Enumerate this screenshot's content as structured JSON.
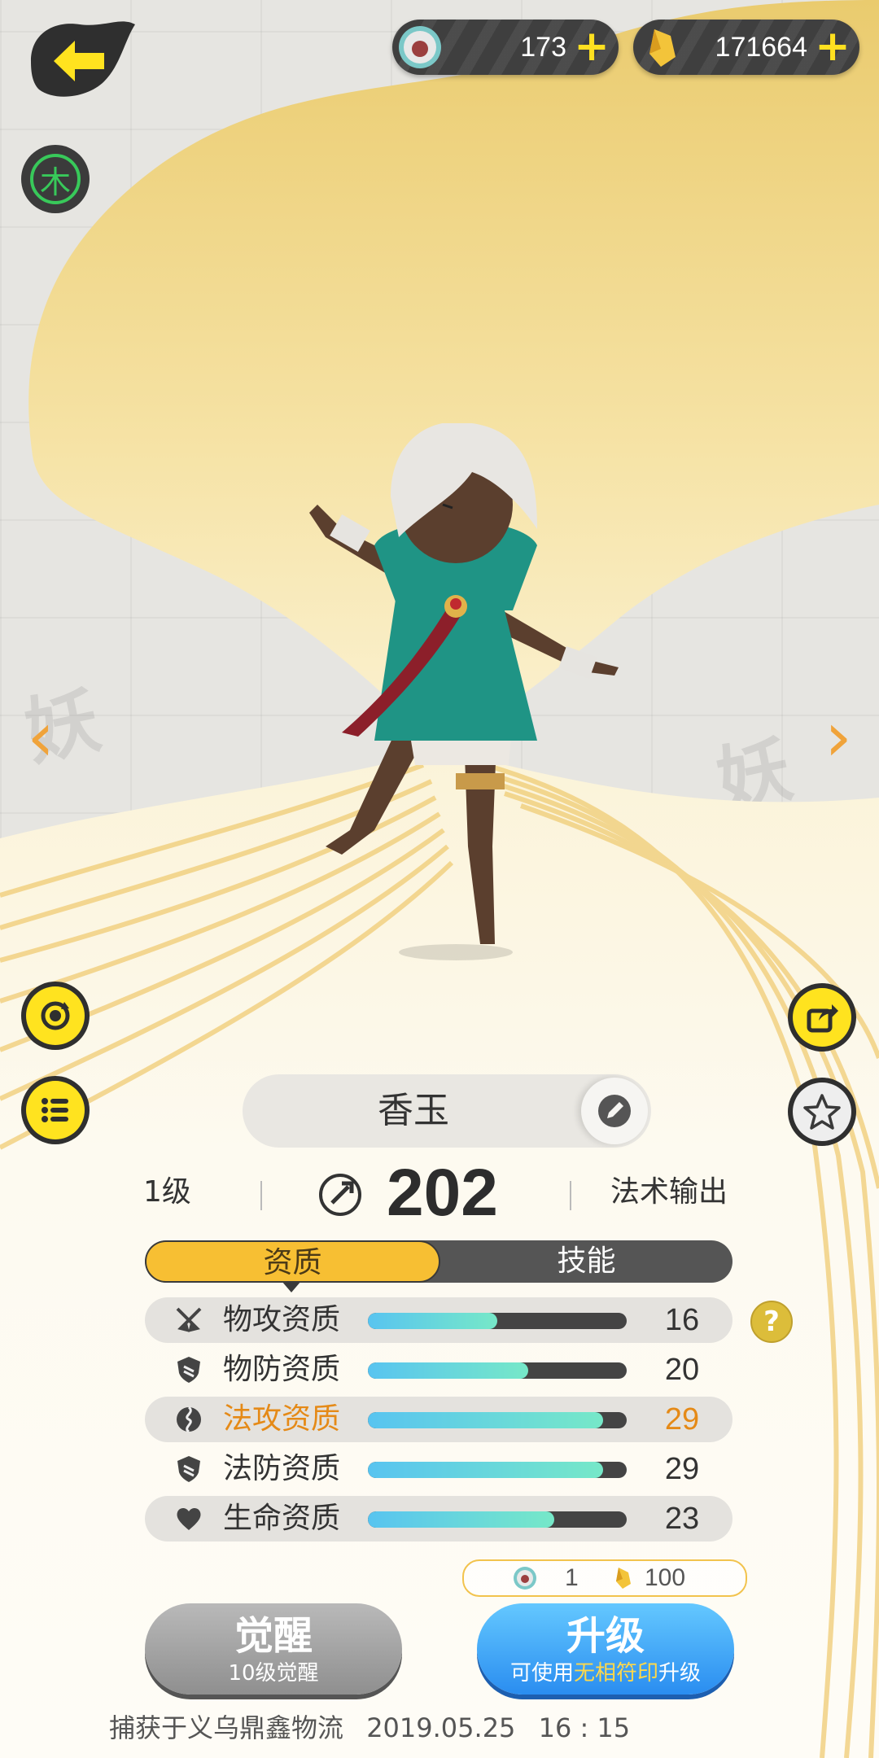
{
  "currencies": [
    {
      "icon": "pearl-coin-icon",
      "value": "173"
    },
    {
      "icon": "gold-crystal-icon",
      "value": "171664"
    }
  ],
  "element_badge": {
    "label": "木",
    "color": "#38c95a"
  },
  "pet": {
    "name": "香玉",
    "level": "1级",
    "power": "202",
    "role": "法术输出"
  },
  "tabs": [
    {
      "label": "资质",
      "active": true
    },
    {
      "label": "技能",
      "active": false
    }
  ],
  "stats": [
    {
      "icon": "sword-icon",
      "label": "物攻资质",
      "value": "16",
      "fill_pct": 50,
      "shaded": true,
      "highlight": false
    },
    {
      "icon": "shield-icon",
      "label": "物防资质",
      "value": "20",
      "fill_pct": 62,
      "shaded": false,
      "highlight": false
    },
    {
      "icon": "magic-orb-icon",
      "label": "法攻资质",
      "value": "29",
      "fill_pct": 91,
      "shaded": true,
      "highlight": true
    },
    {
      "icon": "magic-shield-icon",
      "label": "法防资质",
      "value": "29",
      "fill_pct": 91,
      "shaded": false,
      "highlight": false
    },
    {
      "icon": "heart-icon",
      "label": "生命资质",
      "value": "23",
      "fill_pct": 72,
      "shaded": true,
      "highlight": false
    }
  ],
  "help_label": "?",
  "cost": {
    "pearl": "1",
    "gold": "100"
  },
  "buttons": {
    "awaken": {
      "main": "觉醒",
      "sub": "10级觉醒"
    },
    "upgrade": {
      "main": "升级",
      "sub_prefix": "可使用",
      "sub_highlight": "无相符印",
      "sub_suffix": "升级"
    }
  },
  "footer": {
    "capture": "捕获于义乌鼎鑫物流",
    "date": "2019.05.25",
    "time": "16 : 15"
  },
  "colors": {
    "accent_yellow": "#f7bf33",
    "bar_fill": "#58c4f0",
    "highlight_orange": "#e58a17"
  }
}
